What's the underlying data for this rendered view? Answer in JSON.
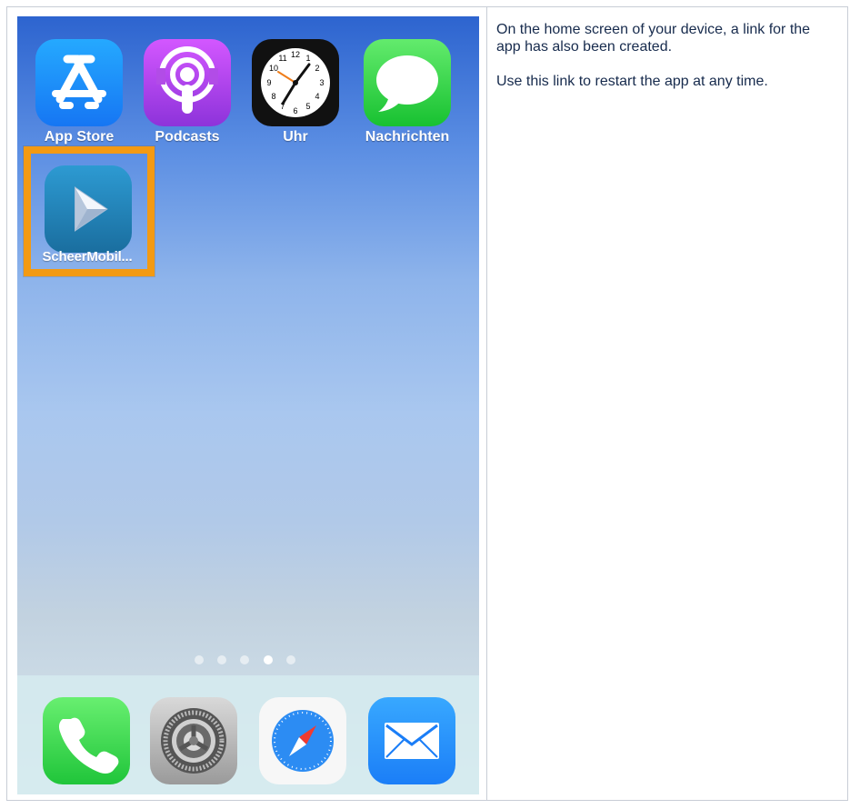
{
  "apps": {
    "row_1": [
      {
        "label": "App Store",
        "icon": "app-store-icon"
      },
      {
        "label": "Podcasts",
        "icon": "podcasts-icon"
      },
      {
        "label": "Uhr",
        "icon": "clock-icon"
      },
      {
        "label": "Nachrichten",
        "icon": "messages-icon"
      }
    ],
    "highlighted": {
      "label": "ScheerMobil...",
      "icon": "scheer-mobile-icon"
    }
  },
  "clock": {
    "numbers": [
      "12",
      "1",
      "2",
      "3",
      "4",
      "5",
      "6",
      "7",
      "8",
      "9",
      "10",
      "11"
    ]
  },
  "dock": [
    {
      "icon": "phone-icon"
    },
    {
      "icon": "settings-icon"
    },
    {
      "icon": "safari-icon"
    },
    {
      "icon": "mail-icon"
    }
  ],
  "page_indicator": {
    "count": 5,
    "active_index": 4
  },
  "highlight_color": "#f39a13",
  "description": {
    "paragraph_1": "On the home screen of your device, a link for the app has also been created.",
    "paragraph_2": "Use this link to restart the app at any time."
  }
}
